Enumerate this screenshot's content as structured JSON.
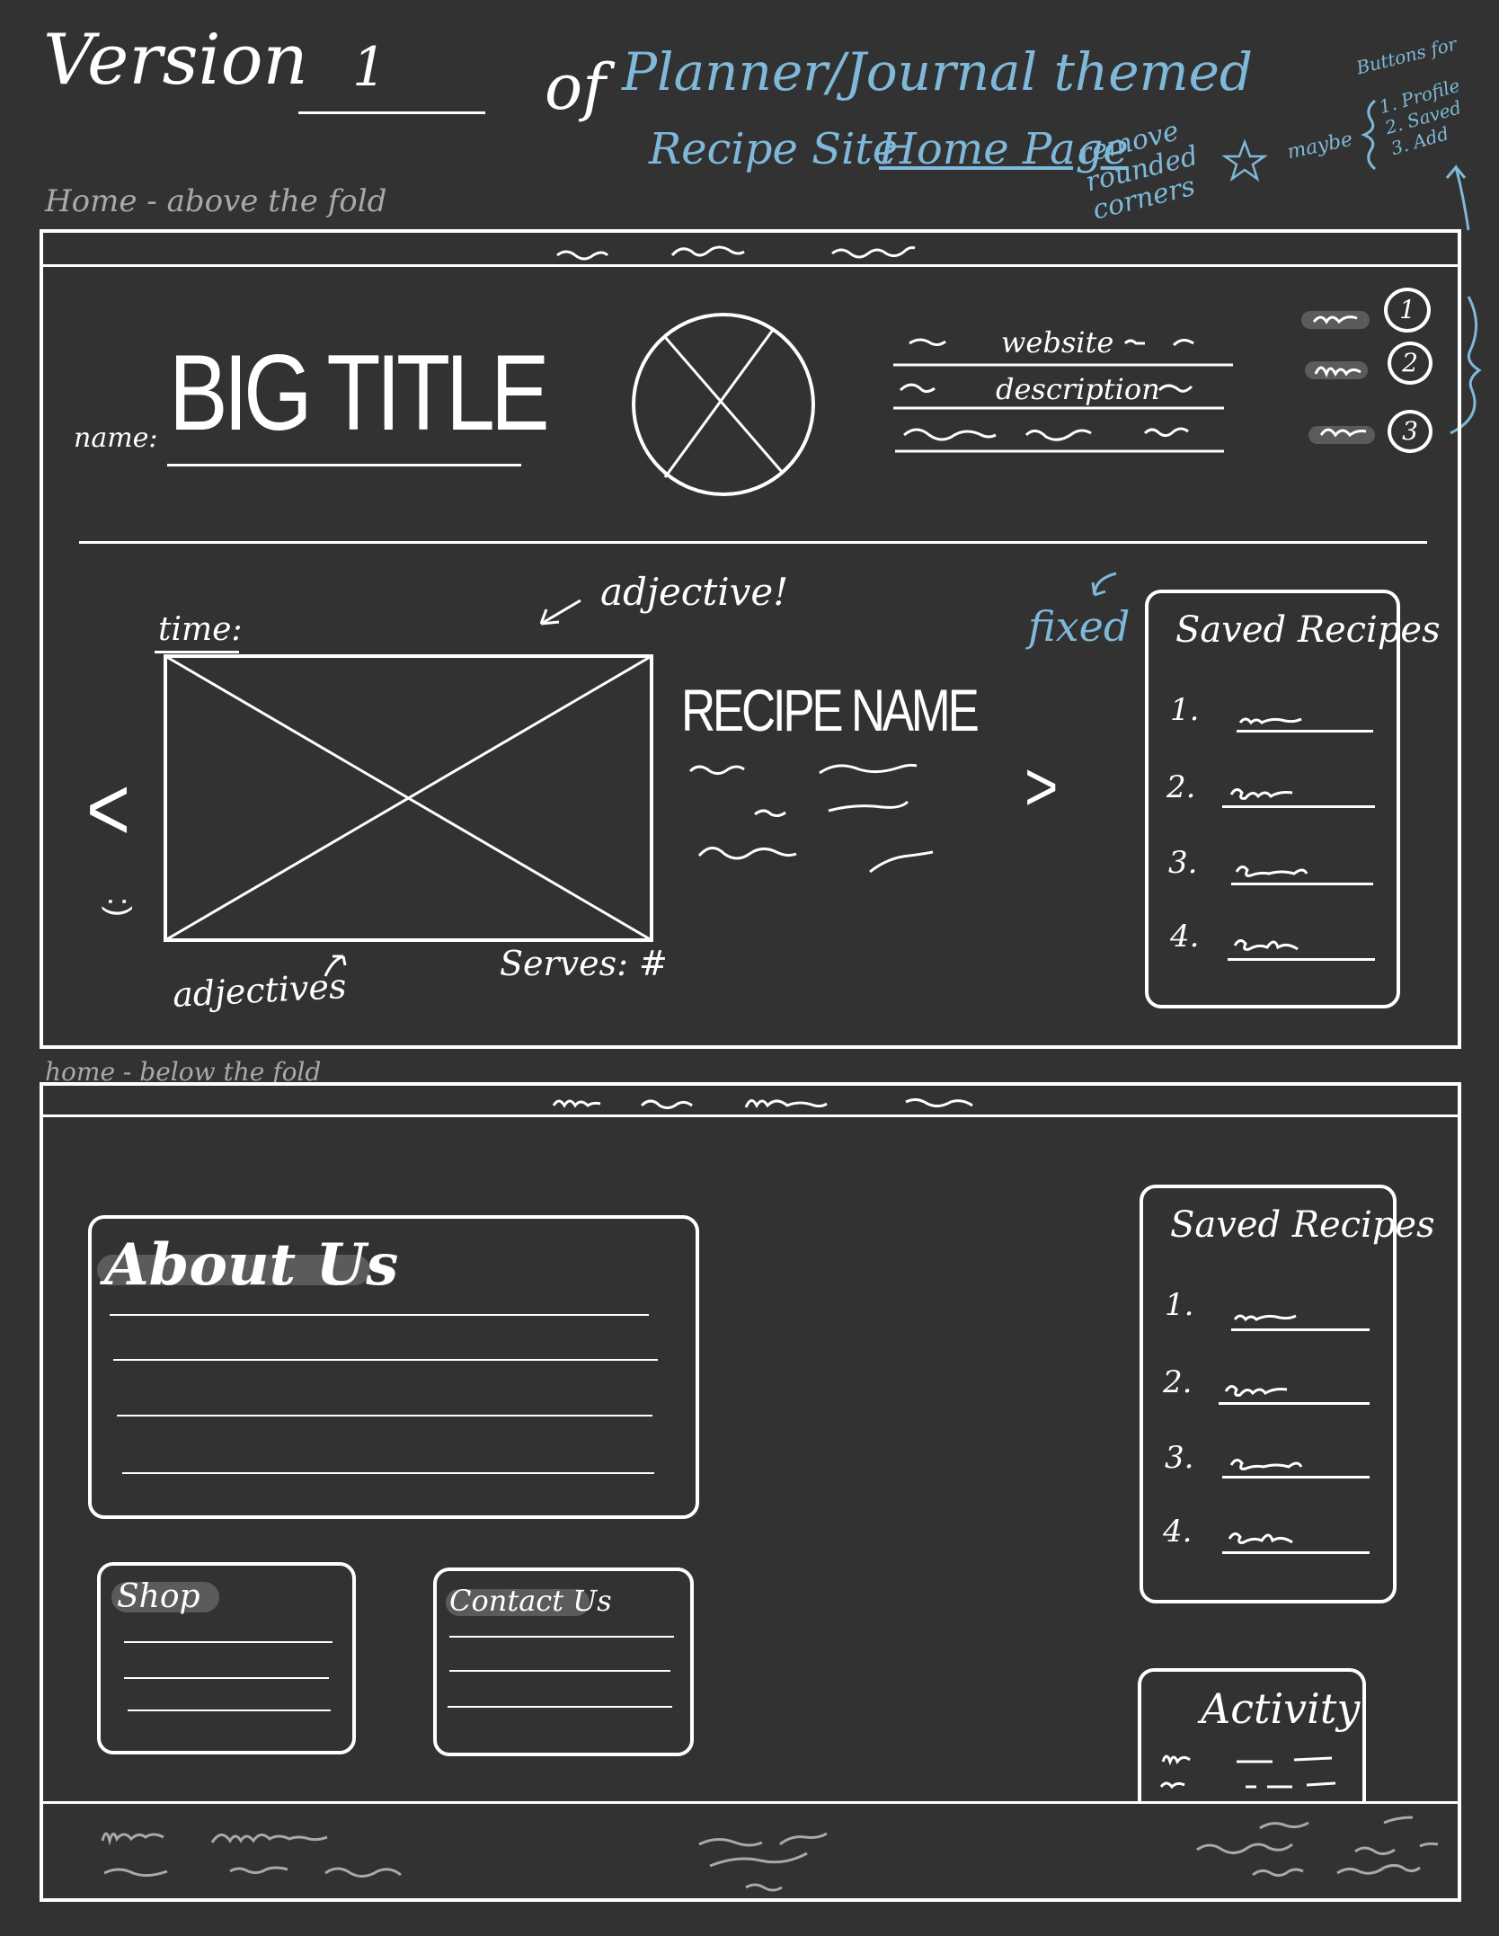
{
  "header": {
    "version_word": "Version",
    "version_number": "1",
    "of_word": "of",
    "subtitle_line1": "Planner/Journal themed",
    "subtitle_line2_part1": "Recipe Site",
    "subtitle_line2_part2": "Home Page",
    "note_remove_corners": "remove rounded corners",
    "note_maybe": "maybe",
    "note_buttons_for": "Buttons for",
    "note_button_list": [
      "1. Profile",
      "2. Saved",
      "3. Add"
    ]
  },
  "above_fold": {
    "section_label": "Home - above the fold",
    "name_label": "name:",
    "big_title": "BIG TITLE",
    "website_label": "website",
    "description_label": "description",
    "button_numbers": [
      "1",
      "2",
      "3"
    ],
    "time_label": "time:",
    "adjective_note": "adjective!",
    "adjectives_label": "adjectives",
    "serves_label": "Serves: #",
    "recipe_name": "RECIPE NAME",
    "fixed_note": "fixed",
    "prev_arrow": "<",
    "next_arrow": ">",
    "smiley": ":)",
    "saved_title": "Saved Recipes",
    "saved_numbers": [
      "1.",
      "2.",
      "3.",
      "4."
    ]
  },
  "below_fold": {
    "section_label": "home - below the fold",
    "about_title": "About Us",
    "shop_title": "Shop",
    "contact_title": "Contact Us",
    "saved_title": "Saved Recipes",
    "saved_numbers": [
      "1.",
      "2.",
      "3.",
      "4."
    ],
    "activity_title": "Activity"
  },
  "colors": {
    "background": "#323232",
    "ink": "#ffffff",
    "annotation_blue": "#7fb8d9",
    "pencil_grey": "#a9a9a9"
  }
}
